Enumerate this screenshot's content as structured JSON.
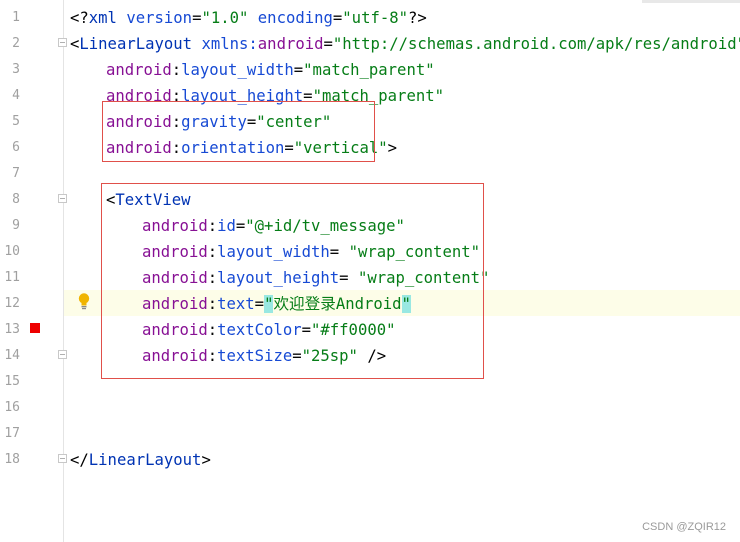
{
  "gutter": {
    "line_numbers": [
      "1",
      "2",
      "3",
      "4",
      "5",
      "6",
      "7",
      "8",
      "9",
      "10",
      "11",
      "12",
      "13",
      "14",
      "15",
      "16",
      "17",
      "18"
    ]
  },
  "code": {
    "l1": {
      "open": "<?",
      "tag": "xml",
      "sp1": " ",
      "a1": "version",
      "eq1": "=",
      "v1": "\"1.0\"",
      "sp2": " ",
      "a2": "encoding",
      "eq2": "=",
      "v2": "\"utf-8\"",
      "close": "?>"
    },
    "l2": {
      "open": "<",
      "tag": "LinearLayout",
      "sp": " ",
      "ns": "xmlns:",
      "attr": "android",
      "eq": "=",
      "val": "\"http://schemas.android.com/apk/res/android\""
    },
    "l3": {
      "ns": "android",
      "colon": ":",
      "attr": "layout_width",
      "eq": "=",
      "val": "\"match_parent\""
    },
    "l4": {
      "ns": "android",
      "colon": ":",
      "attr": "layout_height",
      "eq": "=",
      "val": "\"match_parent\""
    },
    "l5": {
      "ns": "android",
      "colon": ":",
      "attr": "gravity",
      "eq": "=",
      "val": "\"center\""
    },
    "l6": {
      "ns": "android",
      "colon": ":",
      "attr": "orientation",
      "eq": "=",
      "val": "\"vertical\"",
      "close": ">"
    },
    "l8": {
      "open": "<",
      "tag": "TextView"
    },
    "l9": {
      "ns": "android",
      "colon": ":",
      "attr": "id",
      "eq": "=",
      "val": "\"@+id/tv_message\""
    },
    "l10": {
      "ns": "android",
      "colon": ":",
      "attr": "layout_width",
      "eq": "= ",
      "val": "\"wrap_content\""
    },
    "l11": {
      "ns": "android",
      "colon": ":",
      "attr": "layout_height",
      "eq": "= ",
      "val": "\"wrap_content\""
    },
    "l12": {
      "ns": "android",
      "colon": ":",
      "attr": "text",
      "eq": "=",
      "q1": "\"",
      "val": "欢迎登录Android",
      "q2": "\""
    },
    "l13": {
      "ns": "android",
      "colon": ":",
      "attr": "textColor",
      "eq": "=",
      "val": "\"#ff0000\""
    },
    "l14": {
      "ns": "android",
      "colon": ":",
      "attr": "textSize",
      "eq": "=",
      "val": "\"25sp\"",
      "close": " />"
    },
    "l18": {
      "open": "</",
      "tag": "LinearLayout",
      "close": ">"
    }
  },
  "colors": {
    "tag": "#0033b3",
    "namespace": "#871094",
    "attribute": "#174ad4",
    "value": "#067d17",
    "annotation_box": "#e0504a",
    "current_line": "#fdfde8",
    "breakpoint": "#ee0000"
  },
  "icons": {
    "bulb": "lightbulb-icon",
    "breakpoint": "breakpoint-marker-icon"
  },
  "watermark": "CSDN @ZQIR12"
}
